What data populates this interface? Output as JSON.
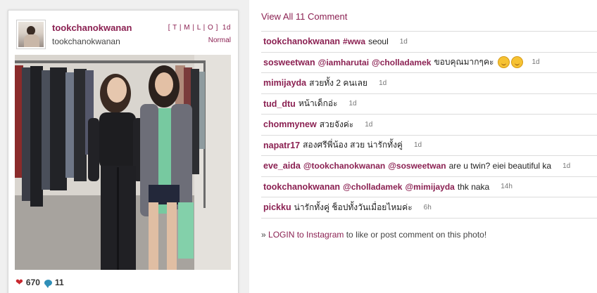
{
  "post": {
    "username": "tookchanokwanan",
    "fullname": "tookchanokwanan",
    "filter_links": "[ T | M | L | O ]",
    "age": "1d",
    "filter_name": "Normal",
    "likes": "670",
    "comments_count": "11",
    "avatar_icon": "profile-photo",
    "like_icon": "heart-icon",
    "comment_icon": "speech-bubble-icon"
  },
  "comments_panel": {
    "view_all": "View All 11 Comment",
    "items": [
      {
        "user": "tookchanokwanan",
        "parts": [
          {
            "text": "#wwa",
            "mention": true
          },
          {
            "text": "seoul",
            "mention": false
          }
        ],
        "age": "1d"
      },
      {
        "user": "sosweetwan",
        "parts": [
          {
            "text": "@iamharutai",
            "mention": true
          },
          {
            "text": "@cholladamek",
            "mention": true
          },
          {
            "text": "ขอบคุณมากๆคะ",
            "mention": false
          }
        ],
        "emoji": 2,
        "age": "1d"
      },
      {
        "user": "mimijayda",
        "parts": [
          {
            "text": "สวยทั้ง 2 คนเลย",
            "mention": false
          }
        ],
        "age": "1d"
      },
      {
        "user": "tud_dtu",
        "parts": [
          {
            "text": "หน้าเด็กอ่ะ",
            "mention": false
          }
        ],
        "age": "1d"
      },
      {
        "user": "chommynew",
        "parts": [
          {
            "text": "สวยจังค่ะ",
            "mention": false
          }
        ],
        "age": "1d"
      },
      {
        "user": "napatr17",
        "parts": [
          {
            "text": "สองศรีพี่น้อง สวย น่ารักทั้งคู่",
            "mention": false
          }
        ],
        "age": "1d"
      },
      {
        "user": "eve_aida",
        "parts": [
          {
            "text": "@tookchanokwanan",
            "mention": true
          },
          {
            "text": "@sosweetwan",
            "mention": true
          },
          {
            "text": "are u twin? eiei beautiful ka",
            "mention": false
          }
        ],
        "age": "1d"
      },
      {
        "user": "tookchanokwanan",
        "parts": [
          {
            "text": "@cholladamek",
            "mention": true
          },
          {
            "text": "@mimijayda",
            "mention": true
          },
          {
            "text": "thk naka",
            "mention": false
          }
        ],
        "age": "14h"
      },
      {
        "user": "pickku",
        "parts": [
          {
            "text": "น่ารักทั้งคู่ ช็อปทั้งวันเมื่อยไหมค่ะ",
            "mention": false
          }
        ],
        "age": "6h"
      }
    ],
    "login_prefix": "» ",
    "login_link": "LOGIN to Instagram",
    "login_suffix": " to like or post comment on this photo!"
  },
  "colors": {
    "accent": "#8b2152",
    "heart": "#c8282f",
    "bubble": "#2f8fb8",
    "panel_bg": "#f0f0f0"
  }
}
